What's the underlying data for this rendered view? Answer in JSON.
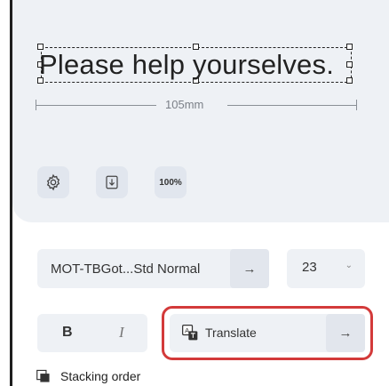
{
  "preview": {
    "text": "Please help yourselves.",
    "dimension_label": "105mm"
  },
  "toolbar": {
    "settings_icon": "gear-icon",
    "download_icon": "download-icon",
    "zoom_label": "100%"
  },
  "font": {
    "name": "MOT-TBGot...Std Normal",
    "apply_arrow": "→",
    "size": "23",
    "size_chevron": "⌄"
  },
  "format": {
    "bold_label": "B",
    "italic_label": "I",
    "translate_label": "Translate",
    "translate_arrow": "→",
    "translate_icon": "translate-icon"
  },
  "stacking": {
    "label": "Stacking order",
    "icon": "layers-icon"
  },
  "colors": {
    "panel_bg": "#eef1f5",
    "highlight_border": "#d33a3a"
  }
}
